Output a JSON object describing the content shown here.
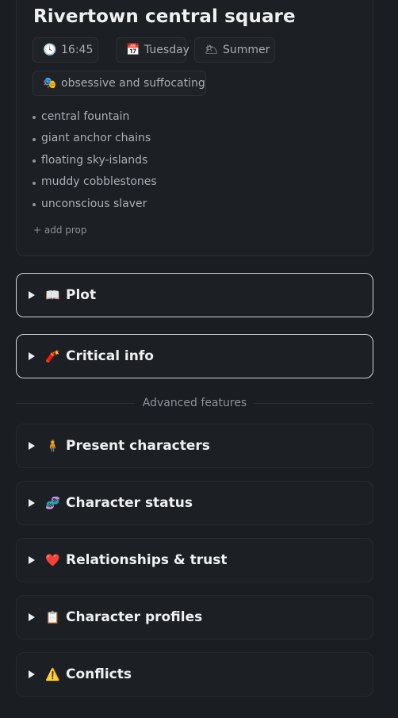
{
  "scene": {
    "title": "Rivertown central square",
    "time": {
      "icon": "clock-icon",
      "glyph": "🕓",
      "value": "16:45"
    },
    "day": {
      "icon": "calendar-icon",
      "glyph": "📅",
      "value": "Tuesday"
    },
    "season": {
      "icon": "sun-behind-cloud-icon",
      "glyph": "🌥",
      "value": "Summer"
    },
    "mood": {
      "icon": "theater-masks-icon",
      "glyph": "🎭",
      "value": "obsessive and suffocating"
    },
    "props": [
      "central fountain",
      "giant anchor chains",
      "floating sky-islands",
      "muddy cobblestones",
      "unconscious slaver"
    ],
    "add_prop_label": "+ add prop"
  },
  "sections": {
    "plot": {
      "label": "Plot",
      "icon": "open-book-icon",
      "glyph": "📖"
    },
    "critical_info": {
      "label": "Critical info",
      "icon": "firecracker-icon",
      "glyph": "🧨"
    },
    "divider_label": "Advanced features",
    "present_characters": {
      "label": "Present characters",
      "icon": "person-standing-icon",
      "glyph": "🧍"
    },
    "character_status": {
      "label": "Character status",
      "icon": "dna-icon",
      "glyph": "🧬"
    },
    "relationships": {
      "label": "Relationships & trust",
      "icon": "red-heart-icon",
      "glyph": "❤️"
    },
    "character_profiles": {
      "label": "Character profiles",
      "icon": "clipboard-icon",
      "glyph": "📋"
    },
    "conflicts": {
      "label": "Conflicts",
      "icon": "warning-icon",
      "glyph": "⚠️"
    }
  }
}
